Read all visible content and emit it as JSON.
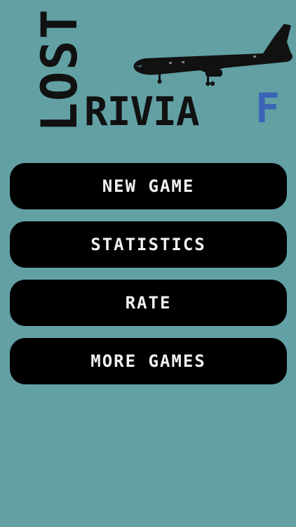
{
  "logo": {
    "lost_text": "LOST",
    "trivia_text": "RIVIA",
    "badge_text": "F"
  },
  "colors": {
    "background": "#62A0A4",
    "button": "#000000",
    "button_text": "#F1F1F1",
    "badge": "#3A64B6"
  },
  "icons": {
    "plane": "airplane-icon"
  },
  "menu": {
    "buttons": [
      {
        "label": "NEW GAME"
      },
      {
        "label": "STATISTICS"
      },
      {
        "label": "RATE"
      },
      {
        "label": "MORE GAMES"
      }
    ]
  }
}
